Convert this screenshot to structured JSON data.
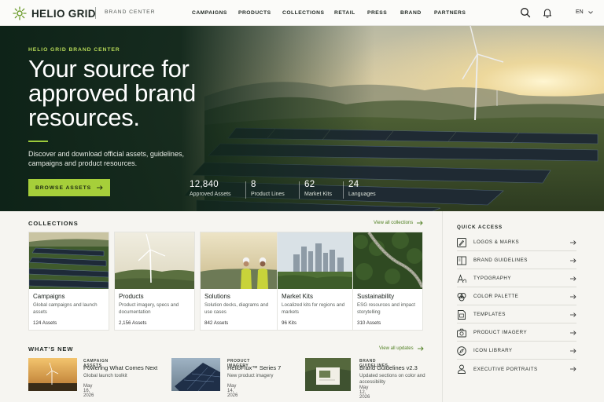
{
  "header": {
    "brand": "HELIO GRID",
    "sub_brand": "BRAND CENTER",
    "nav": [
      "CAMPAIGNS",
      "PRODUCTS",
      "COLLECTIONS",
      "RETAIL",
      "PRESS",
      "BRAND",
      "PARTNERS"
    ],
    "language": "EN",
    "icons": [
      "search-icon",
      "bell-icon",
      "chevron-down-icon"
    ]
  },
  "hero": {
    "eyebrow": "HELIO GRID BRAND CENTER",
    "title": "Your source for approved brand resources.",
    "description": "Discover and download official assets, guidelines, campaigns and product resources.",
    "cta": "BROWSE ASSETS",
    "stats": [
      {
        "value": "12,840",
        "label": "Approved Assets"
      },
      {
        "value": "8",
        "label": "Product Lines"
      },
      {
        "value": "62",
        "label": "Market Kits"
      },
      {
        "value": "24",
        "label": "Languages"
      }
    ]
  },
  "collections": {
    "title": "COLLECTIONS",
    "link": "View all collections",
    "items": [
      {
        "title": "Campaigns",
        "desc": "Global campaigns and launch assets",
        "count": "124 Assets"
      },
      {
        "title": "Products",
        "desc": "Product imagery, specs and documentation",
        "count": "2,156 Assets"
      },
      {
        "title": "Solutions",
        "desc": "Solution decks, diagrams and use cases",
        "count": "842 Assets"
      },
      {
        "title": "Market Kits",
        "desc": "Localized kits for regions and markets",
        "count": "96 Kits"
      },
      {
        "title": "Sustainability",
        "desc": "ESG resources and impact storytelling",
        "count": "310 Assets"
      }
    ]
  },
  "whats_new": {
    "title": "WHAT'S NEW",
    "link": "View all updates",
    "items": [
      {
        "category": "CAMPAIGN ASSETS",
        "title": "Powering What Comes Next",
        "desc": "Global launch toolkit",
        "date": "May 16, 2026"
      },
      {
        "category": "PRODUCT IMAGERY",
        "title": "HelioFlux™ Series 7",
        "desc": "New product imagery",
        "date": "May 14, 2026"
      },
      {
        "category": "BRAND GUIDELINES",
        "title": "Brand Guidelines v2.3",
        "desc": "Updated sections on color and accessibility",
        "date": "May 12, 2026"
      }
    ]
  },
  "quick_access": {
    "title": "QUICK ACCESS",
    "items": [
      {
        "label": "LOGOS & MARKS",
        "icon": "pen-nib-icon"
      },
      {
        "label": "BRAND GUIDELINES",
        "icon": "book-icon"
      },
      {
        "label": "TYPOGRAPHY",
        "icon": "type-icon"
      },
      {
        "label": "COLOR PALETTE",
        "icon": "palette-icon"
      },
      {
        "label": "TEMPLATES",
        "icon": "template-icon"
      },
      {
        "label": "PRODUCT IMAGERY",
        "icon": "camera-icon"
      },
      {
        "label": "ICON LIBRARY",
        "icon": "compass-icon"
      },
      {
        "label": "EXECUTIVE PORTRAITS",
        "icon": "person-icon"
      }
    ]
  },
  "colors": {
    "accent": "#a6cf3a",
    "accent_text": "#b6d957",
    "dark": "#1d2420"
  }
}
